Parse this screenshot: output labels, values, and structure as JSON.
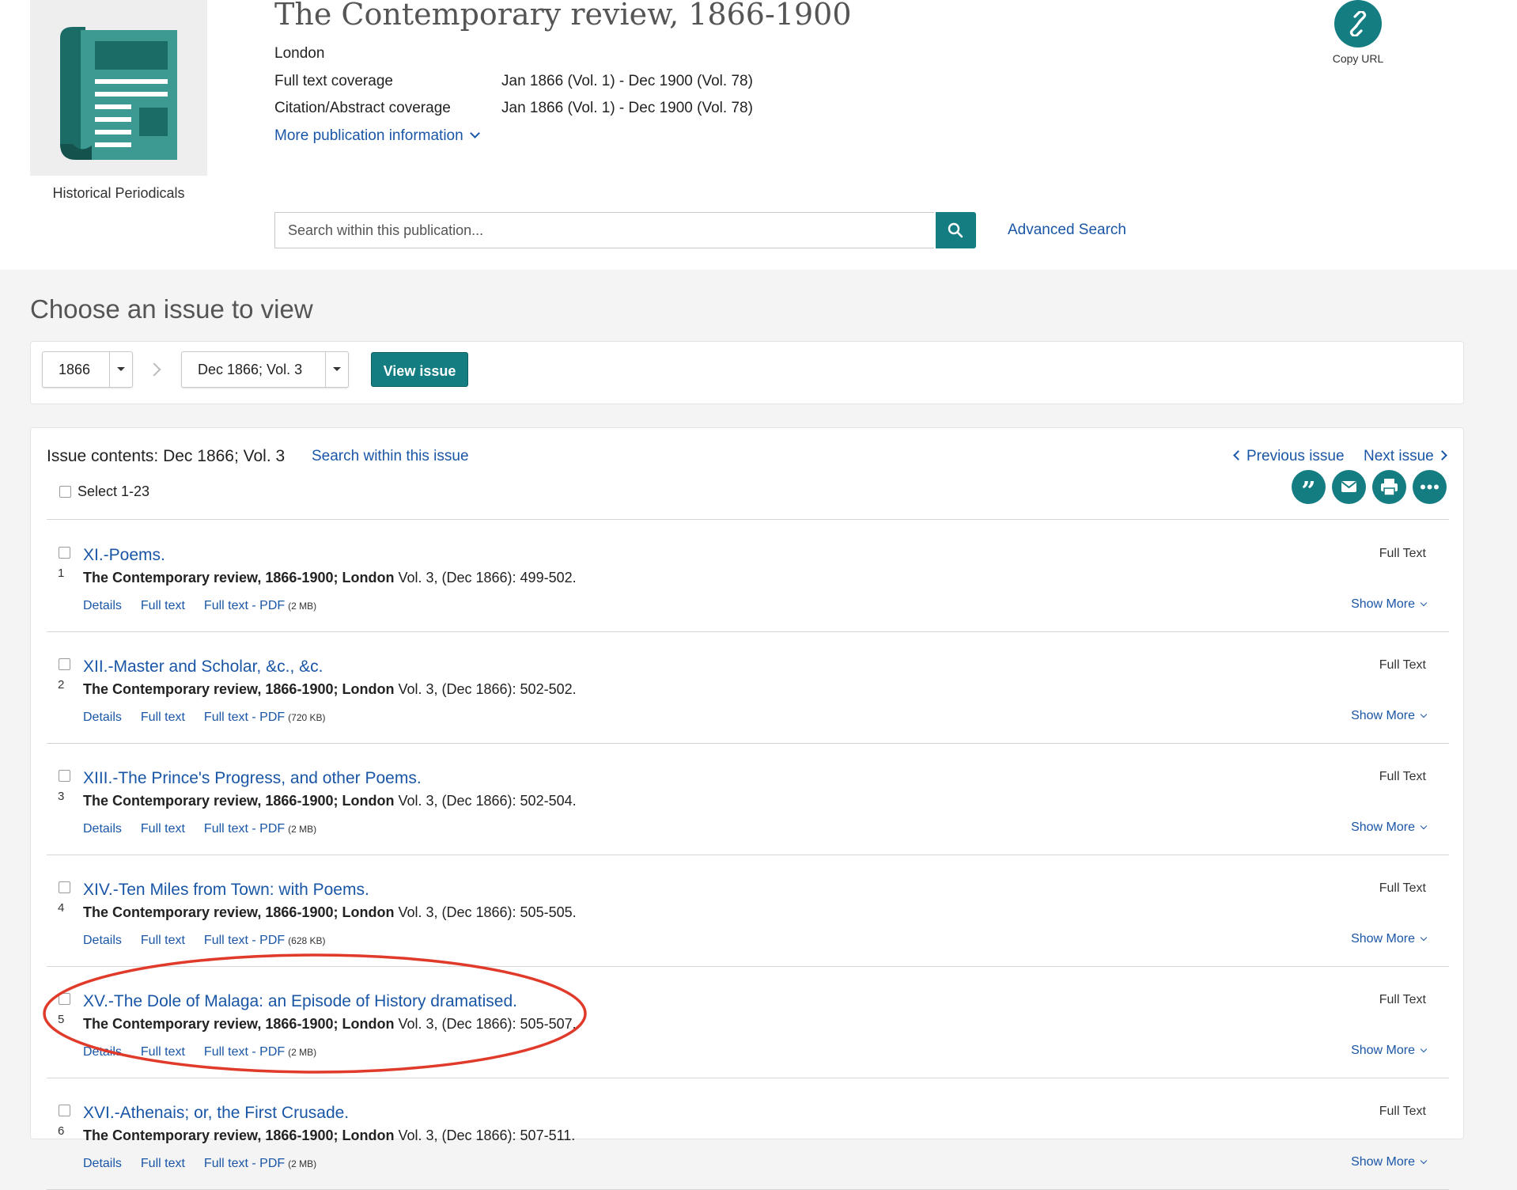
{
  "publication": {
    "thumbnail_caption": "Historical Periodicals",
    "title": "The Contemporary review, 1866-1900",
    "place": "London",
    "full_text_label": "Full text coverage",
    "full_text_value": "Jan 1866 (Vol. 1) - Dec 1900 (Vol. 78)",
    "citation_label": "Citation/Abstract coverage",
    "citation_value": "Jan 1866 (Vol. 1) - Dec 1900 (Vol. 78)",
    "more_info_label": "More publication information",
    "copy_url_label": "Copy URL"
  },
  "search": {
    "placeholder": "Search within this publication...",
    "advanced_label": "Advanced Search"
  },
  "chooser": {
    "heading": "Choose an issue to view",
    "year_value": "1866",
    "issue_value": "Dec 1866; Vol. 3",
    "view_button": "View issue"
  },
  "contents": {
    "heading": "Issue contents: Dec 1866; Vol. 3",
    "search_issue_label": "Search within this issue",
    "previous_label": "Previous issue",
    "next_label": "Next issue",
    "select_all_label": "Select 1-23",
    "tools": [
      "cite-icon",
      "email-icon",
      "print-icon",
      "more-icon"
    ],
    "items": [
      {
        "number": "1",
        "title": "XI.-Poems.",
        "source": "The Contemporary review, 1866-1900; London",
        "detail": "Vol. 3,  (Dec 1866): 499-502.",
        "details_label": "Details",
        "fulltext_label": "Full text",
        "pdf_label": "Full text - PDF",
        "pdf_size": "(2 MB)",
        "availability": "Full Text",
        "show_more_label": "Show More"
      },
      {
        "number": "2",
        "title": "XII.-Master and Scholar, &c., &c.",
        "source": "The Contemporary review, 1866-1900; London",
        "detail": "Vol. 3,  (Dec 1866): 502-502.",
        "details_label": "Details",
        "fulltext_label": "Full text",
        "pdf_label": "Full text - PDF",
        "pdf_size": "(720 KB)",
        "availability": "Full Text",
        "show_more_label": "Show More"
      },
      {
        "number": "3",
        "title": "XIII.-The Prince's Progress, and other Poems.",
        "source": "The Contemporary review, 1866-1900; London",
        "detail": "Vol. 3,  (Dec 1866): 502-504.",
        "details_label": "Details",
        "fulltext_label": "Full text",
        "pdf_label": "Full text - PDF",
        "pdf_size": "(2 MB)",
        "availability": "Full Text",
        "show_more_label": "Show More"
      },
      {
        "number": "4",
        "title": "XIV.-Ten Miles from Town: with Poems.",
        "source": "The Contemporary review, 1866-1900; London",
        "detail": "Vol. 3,  (Dec 1866): 505-505.",
        "details_label": "Details",
        "fulltext_label": "Full text",
        "pdf_label": "Full text - PDF",
        "pdf_size": "(628 KB)",
        "availability": "Full Text",
        "show_more_label": "Show More"
      },
      {
        "number": "5",
        "title": "XV.-The Dole of Malaga: an Episode of History dramatised.",
        "source": "The Contemporary review, 1866-1900; London",
        "detail": "Vol. 3,  (Dec 1866): 505-507.",
        "details_label": "Details",
        "fulltext_label": "Full text",
        "pdf_label": "Full text - PDF",
        "pdf_size": "(2 MB)",
        "availability": "Full Text",
        "show_more_label": "Show More"
      },
      {
        "number": "6",
        "title": "XVI.-Athenais; or, the First Crusade.",
        "source": "The Contemporary review, 1866-1900; London",
        "detail": "Vol. 3,  (Dec 1866): 507-511.",
        "details_label": "Details",
        "fulltext_label": "Full text",
        "pdf_label": "Full text - PDF",
        "pdf_size": "(2 MB)",
        "availability": "Full Text",
        "show_more_label": "Show More"
      }
    ]
  },
  "colors": {
    "accent_teal": "#147d82",
    "link_blue": "#1a56a6",
    "annotation_red": "#e03a2a"
  }
}
